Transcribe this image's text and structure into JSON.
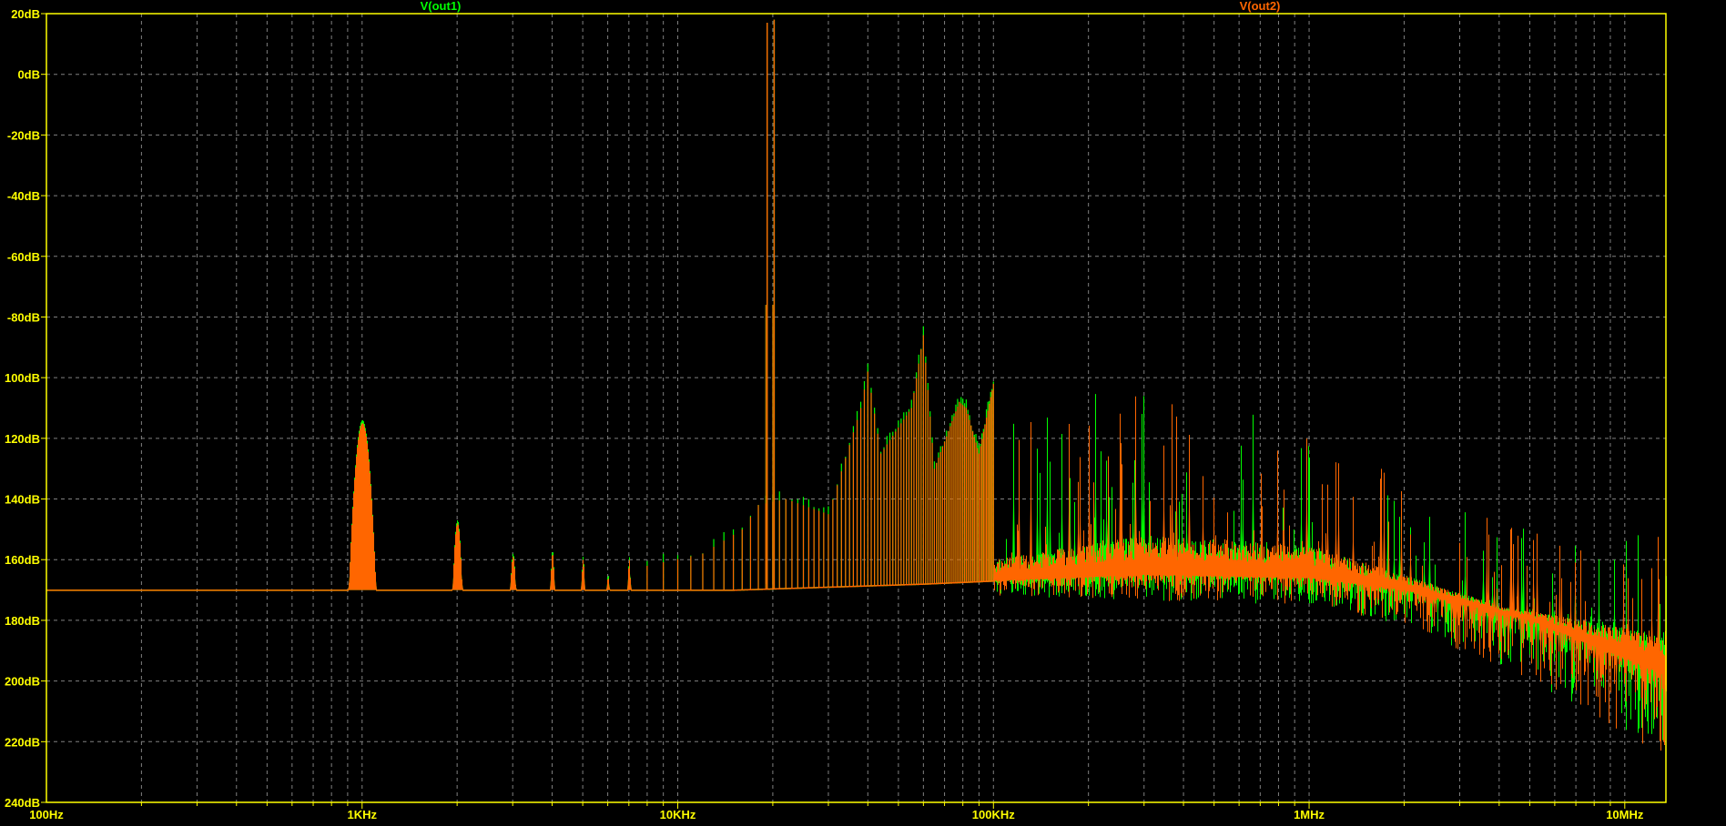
{
  "chart_data": {
    "type": "line",
    "title": "",
    "xscale": "log",
    "xlim": [
      100,
      13500000
    ],
    "ylim": [
      -240,
      20
    ],
    "grid": true,
    "background_color": "#000000",
    "axis_color": "#ffff00",
    "grid_color": "#808080",
    "x_tick_labels": [
      {
        "value": 100,
        "label": "100Hz"
      },
      {
        "value": 1000,
        "label": "1KHz"
      },
      {
        "value": 10000,
        "label": "10KHz"
      },
      {
        "value": 100000,
        "label": "100KHz"
      },
      {
        "value": 1000000,
        "label": "1MHz"
      },
      {
        "value": 10000000,
        "label": "10MHz"
      }
    ],
    "y_tick_labels": [
      {
        "value": 20,
        "label": "20dB"
      },
      {
        "value": 0,
        "label": "0dB"
      },
      {
        "value": -20,
        "label": "-20dB"
      },
      {
        "value": -40,
        "label": "-40dB"
      },
      {
        "value": -60,
        "label": "-60dB"
      },
      {
        "value": -80,
        "label": "-80dB"
      },
      {
        "value": -100,
        "label": "100dB"
      },
      {
        "value": -120,
        "label": "120dB"
      },
      {
        "value": -140,
        "label": "140dB"
      },
      {
        "value": -160,
        "label": "160dB"
      },
      {
        "value": -180,
        "label": "180dB"
      },
      {
        "value": -200,
        "label": "200dB"
      },
      {
        "value": -220,
        "label": "220dB"
      },
      {
        "value": -240,
        "label": "240dB"
      }
    ],
    "series": [
      {
        "name": "V(out1)",
        "color": "#00ff00"
      },
      {
        "name": "V(out2)",
        "color": "#ff6600"
      }
    ],
    "noise_floor": [
      [
        100,
        -170
      ],
      [
        15000,
        -170
      ],
      [
        60000,
        -168
      ],
      [
        100000,
        -167
      ],
      [
        300000,
        -165
      ],
      [
        1000000,
        -166
      ],
      [
        2000000,
        -170
      ],
      [
        5000000,
        -180
      ],
      [
        13500000,
        -198
      ]
    ],
    "noise_band_top": [
      [
        100000,
        -160
      ],
      [
        300000,
        -152
      ],
      [
        1000000,
        -155
      ],
      [
        2000000,
        -165
      ],
      [
        4000000,
        -175
      ],
      [
        13500000,
        -185
      ]
    ],
    "noise_spike_top": [
      [
        100000,
        -105
      ],
      [
        300000,
        -105
      ],
      [
        1000000,
        -112
      ],
      [
        2000000,
        -135
      ],
      [
        5000000,
        -150
      ],
      [
        13500000,
        -150
      ]
    ],
    "noise_dip_bottom": [
      [
        100000,
        -172
      ],
      [
        1000000,
        -175
      ],
      [
        2000000,
        -182
      ],
      [
        5000000,
        -200
      ],
      [
        13500000,
        -225
      ]
    ],
    "bumps": [
      {
        "f": 1000,
        "db": -115,
        "width": 0.1
      },
      {
        "f": 2000,
        "db": -148,
        "width": 0.035
      },
      {
        "f": 3000,
        "db": -159,
        "width": 0.02
      },
      {
        "f": 4000,
        "db": -158,
        "width": 0.015
      },
      {
        "f": 5000,
        "db": -160,
        "width": 0.012
      },
      {
        "f": 6000,
        "db": -166,
        "width": 0.01
      },
      {
        "f": 7000,
        "db": -160,
        "width": 0.01
      }
    ],
    "comb_spacing_hz": 1000,
    "comb_range": [
      8000,
      100000
    ],
    "comb_envelope": [
      [
        8000,
        -162
      ],
      [
        12000,
        -158
      ],
      [
        16000,
        -150
      ],
      [
        18000,
        -142
      ],
      [
        22000,
        -140
      ],
      [
        30000,
        -145
      ],
      [
        38000,
        -110
      ],
      [
        40000,
        -98
      ],
      [
        44000,
        -125
      ],
      [
        55000,
        -110
      ],
      [
        60000,
        -86
      ],
      [
        65000,
        -130
      ],
      [
        78000,
        -108
      ],
      [
        82000,
        -110
      ],
      [
        90000,
        -125
      ],
      [
        100000,
        -102
      ]
    ],
    "main_peaks": [
      {
        "f": 19200,
        "db": 17
      },
      {
        "f": 20200,
        "db": 18
      }
    ]
  }
}
